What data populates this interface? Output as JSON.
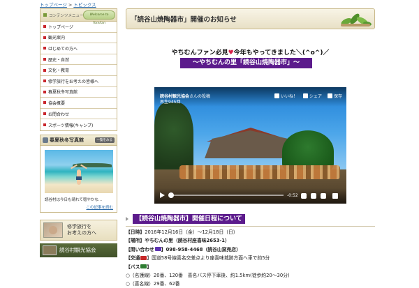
{
  "breadcrumb": {
    "home": "トップページ",
    "sep": ">",
    "current": "トピックス"
  },
  "sidebar": {
    "menu_title": "コンテンツメニュー",
    "menu_badge": "Welcome to Yomitan",
    "items": [
      {
        "label": "トップページ"
      },
      {
        "label": "観光案内"
      },
      {
        "label": "はじめての方へ"
      },
      {
        "label": "歴史・自然"
      },
      {
        "label": "文化・教育"
      },
      {
        "label": "修学旅行をお考えの皆様へ"
      },
      {
        "label": "春夏秋冬写真館"
      },
      {
        "label": "協会概要"
      },
      {
        "label": "お問合わせ"
      },
      {
        "label": "スポーツ情報(キャンプ)"
      }
    ],
    "photo": {
      "title": "春夏秋冬写真館",
      "list_button": "一覧をみる",
      "caption": "読谷村は今日も晴れて穏やかな...",
      "more_link": "この記事を読む"
    },
    "banner1": {
      "line1": "修学旅行を",
      "line2": "お考えの方へ"
    },
    "banner2": {
      "label": "読谷村観光協会"
    }
  },
  "main": {
    "page_title": "「読谷山焼陶器市」開催のお知らせ",
    "intro_pre": "やちむんファン必見",
    "intro_heart": "♥",
    "intro_post": "今年もやってきました＼(^o^)／",
    "highlight": "〜やちむんの里「読谷山焼陶器市」〜",
    "video": {
      "page_name": "読谷村観光協会",
      "posted_suffix": "さんの投稿",
      "views": "再生945回",
      "like": "いいね！",
      "share": "シェア",
      "save": "保存",
      "time": "-0:52"
    },
    "section_title": "【読谷山焼陶器市】開催日程について",
    "details": {
      "date_label": "【日時】",
      "date_value": "2016年12月16日（金）〜12月18日（日）",
      "place_label": "【場所】",
      "place_value": "やちむんの里（読谷村座喜味2653-1）",
      "contact_label": "【問い合わせ",
      "contact_value": "】098-958-4468（読谷山窯売店）",
      "traffic_label": "【交通",
      "traffic_value": "】国道58号線喜名交差点より座喜味城跡方面へ車で約5分",
      "bus_label": "【バス",
      "bus_value": "】",
      "bus_line1": "○（名護線）20番、120番　喜名バス停下車後、約1.5km(徒歩約20〜30分)",
      "bus_line2": "○（喜名線）29番、62番"
    }
  }
}
